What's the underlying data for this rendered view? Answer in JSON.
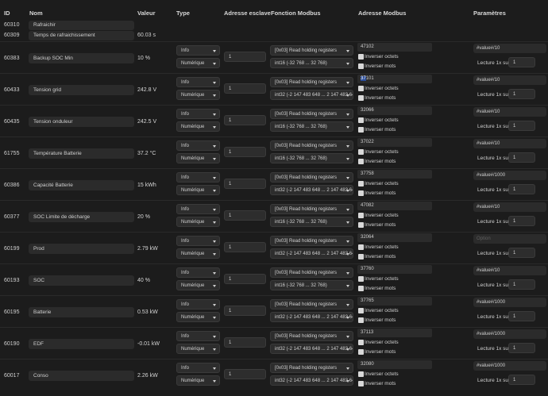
{
  "headers": {
    "id": "ID",
    "nom": "Nom",
    "valeur": "Valeur",
    "type": "Type",
    "adresse_esclave": "Adresse esclave",
    "fonction_modbus": "Fonction Modbus",
    "adresse_modbus": "Adresse Modbus",
    "parametres": "Paramètres"
  },
  "simple_rows": [
    {
      "id": "60310",
      "name": "Rafraichir",
      "value": ""
    },
    {
      "id": "60309",
      "name": "Temps de rafraichissement",
      "value": "60.03 s"
    }
  ],
  "labels": {
    "inverser_octets": "Inverser octets",
    "inverser_mots": "Inverser mots",
    "lecture": "Lecture 1x sur :"
  },
  "rows": [
    {
      "id": "60383",
      "name": "Backup SOC Min",
      "value": "10 %",
      "type1": "Info",
      "type2": "Numérique",
      "slave": "1",
      "func": "[0x03] Read holding registers",
      "format": "int16 (-32 768 ... 32 768)",
      "addr": "47102",
      "addr_hl": "",
      "param": "#value#/10",
      "param_placeholder": false,
      "lecture": "1"
    },
    {
      "id": "60433",
      "name": "Tension grid",
      "value": "242.8 V",
      "type1": "Info",
      "type2": "Numérique",
      "slave": "1",
      "func": "[0x03] Read holding registers",
      "format": "int32 (-2 147 483 648 ... 2 147 483 647)",
      "addr": "101",
      "addr_hl": "37",
      "param": "#value#/10",
      "param_placeholder": false,
      "lecture": "1"
    },
    {
      "id": "60435",
      "name": "Tension onduleur",
      "value": "242.5 V",
      "type1": "Info",
      "type2": "Numérique",
      "slave": "1",
      "func": "[0x03] Read holding registers",
      "format": "int16 (-32 768 ... 32 768)",
      "addr": "32066",
      "addr_hl": "",
      "param": "#value#/10",
      "param_placeholder": false,
      "lecture": "1"
    },
    {
      "id": "61755",
      "name": "Température Batterie",
      "value": "37.2 °C",
      "type1": "Info",
      "type2": "Numérique",
      "slave": "1",
      "func": "[0x03] Read holding registers",
      "format": "int16 (-32 768 ... 32 768)",
      "addr": "37022",
      "addr_hl": "",
      "param": "#value#/10",
      "param_placeholder": false,
      "lecture": "1"
    },
    {
      "id": "60386",
      "name": "Capacité Batterie",
      "value": "15 kWh",
      "type1": "Info",
      "type2": "Numérique",
      "slave": "1",
      "func": "[0x03] Read holding registers",
      "format": "int32 (-2 147 483 648 ... 2 147 483 647)",
      "addr": "37758",
      "addr_hl": "",
      "param": "#value#/1000",
      "param_placeholder": false,
      "lecture": "1"
    },
    {
      "id": "60377",
      "name": "SOC Limite de décharge",
      "value": "20 %",
      "type1": "Info",
      "type2": "Numérique",
      "slave": "1",
      "func": "[0x03] Read holding registers",
      "format": "int16 (-32 768 ... 32 768)",
      "addr": "47082",
      "addr_hl": "",
      "param": "#value#/10",
      "param_placeholder": false,
      "lecture": "1"
    },
    {
      "id": "60199",
      "name": "Prod",
      "value": "2.79 kW",
      "type1": "Info",
      "type2": "Numérique",
      "slave": "1",
      "func": "[0x03] Read holding registers",
      "format": "int32 (-2 147 483 648 ... 2 147 483 647)",
      "addr": "32064",
      "addr_hl": "",
      "param": "Option",
      "param_placeholder": true,
      "lecture": "1"
    },
    {
      "id": "60193",
      "name": "SOC",
      "value": "40 %",
      "type1": "Info",
      "type2": "Numérique",
      "slave": "1",
      "func": "[0x03] Read holding registers",
      "format": "int16 (-32 768 ... 32 768)",
      "addr": "37760",
      "addr_hl": "",
      "param": "#value#/10",
      "param_placeholder": false,
      "lecture": "1"
    },
    {
      "id": "60195",
      "name": "Batterie",
      "value": "0.53 kW",
      "type1": "Info",
      "type2": "Numérique",
      "slave": "1",
      "func": "[0x03] Read holding registers",
      "format": "int32 (-2 147 483 648 ... 2 147 483 647)",
      "addr": "37765",
      "addr_hl": "",
      "param": "#value#/1000",
      "param_placeholder": false,
      "lecture": "1"
    },
    {
      "id": "60190",
      "name": "EDF",
      "value": "-0.01 kW",
      "type1": "Info",
      "type2": "Numérique",
      "slave": "1",
      "func": "[0x03] Read holding registers",
      "format": "int32 (-2 147 483 648 ... 2 147 483 647)",
      "addr": "37113",
      "addr_hl": "",
      "param": "#value#/1000",
      "param_placeholder": false,
      "lecture": "1"
    },
    {
      "id": "60017",
      "name": "Conso",
      "value": "2.26 kW",
      "type1": "Info",
      "type2": "Numérique",
      "slave": "1",
      "func": "[0x03] Read holding registers",
      "format": "int32 (-2 147 483 648 ... 2 147 483 647)",
      "addr": "32080",
      "addr_hl": "",
      "param": "#value#/1000",
      "param_placeholder": false,
      "lecture": "1"
    }
  ]
}
